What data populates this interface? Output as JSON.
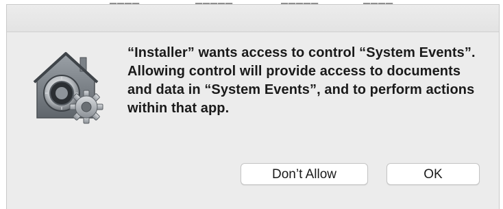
{
  "dialog": {
    "app_name": "Installer",
    "target_app": "System Events",
    "message": "“Installer” wants access to control “System Events”. Allowing control will provide access to documents and data in “System Events”, and to perform actions within that app.",
    "icon": "gatekeeper-lock-gear-icon"
  },
  "buttons": {
    "dont_allow_label": "Don’t Allow",
    "ok_label": "OK"
  },
  "colors": {
    "dialog_bg": "#ececec",
    "button_bg": "#ffffff",
    "text": "#1a1a1a"
  }
}
